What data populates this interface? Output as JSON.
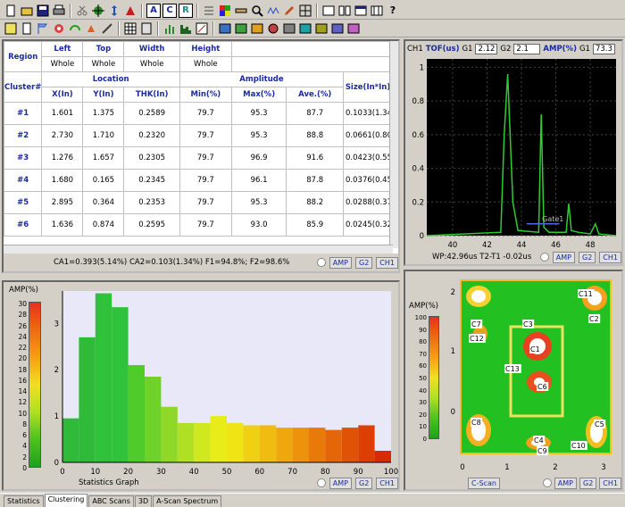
{
  "toolbar1": {
    "buttons": [
      "new-doc-icon",
      "open-folder-icon",
      "save-icon",
      "print-icon",
      "cut-icon",
      "arrow-icon",
      "crosshair-icon",
      "move-icon",
      "letter-a-icon",
      "letter-c-icon",
      "letter-r-icon",
      "list-icon",
      "palette-icon",
      "ruler-icon",
      "zoom-icon",
      "trace-icon",
      "pencil-icon",
      "grid-icon",
      "layout1-icon",
      "layout2-icon",
      "window-icon",
      "split-icon",
      "help-icon"
    ],
    "labels": {
      "a": "A",
      "c": "C",
      "r": "R",
      "help": "?"
    }
  },
  "table": {
    "col_headers_row1": [
      "Region",
      "Left",
      "Top",
      "Width",
      "Height",
      ""
    ],
    "col_headers_row2": [
      "",
      "Whole",
      "Whole",
      "Whole",
      "Whole",
      ""
    ],
    "group_row": {
      "cluster": "Cluster#",
      "location": "Location",
      "amplitude": "Amplitude",
      "size": "Size(In*In)"
    },
    "sub_headers": [
      "X(In)",
      "Y(In)",
      "THK(In)",
      "Min(%)",
      "Max(%)",
      "Ave.(%)"
    ],
    "rows": [
      {
        "id": "#1",
        "x": "1.601",
        "y": "1.375",
        "thk": "0.2589",
        "min": "79.7",
        "max": "95.3",
        "ave": "87.7",
        "size": "0.1033(1.34"
      },
      {
        "id": "#2",
        "x": "2.730",
        "y": "1.710",
        "thk": "0.2320",
        "min": "79.7",
        "max": "95.3",
        "ave": "88.8",
        "size": "0.0661(0.80"
      },
      {
        "id": "#3",
        "x": "1.276",
        "y": "1.657",
        "thk": "0.2305",
        "min": "79.7",
        "max": "96.9",
        "ave": "91.6",
        "size": "0.0423(0.55"
      },
      {
        "id": "#4",
        "x": "1.680",
        "y": "0.165",
        "thk": "0.2345",
        "min": "79.7",
        "max": "96.1",
        "ave": "87.8",
        "size": "0.0376(0.45"
      },
      {
        "id": "#5",
        "x": "2.895",
        "y": "0.364",
        "thk": "0.2353",
        "min": "79.7",
        "max": "95.3",
        "ave": "88.2",
        "size": "0.0288(0.37"
      },
      {
        "id": "#6",
        "x": "1.636",
        "y": "0.874",
        "thk": "0.2595",
        "min": "79.7",
        "max": "93.0",
        "ave": "85.9",
        "size": "0.0245(0.32"
      }
    ],
    "status": "CA1=0.393(5.14%) CA2=0.103(1.34%) F1=94.8%; F2=98.6%",
    "tabs": [
      "AMP",
      "G2",
      "CH1"
    ]
  },
  "ascan": {
    "channel": "CH1",
    "tof_label": "TOF(us)",
    "g1_label": "G1",
    "g1_value": "2.12",
    "g2_label": "G2",
    "g2_value": "2.1",
    "amp_label": "AMP(%)",
    "amp_g1_label": "G1",
    "amp_g1_value": "73.3",
    "gate_label": "Gate1",
    "readout": "WP:42.96us T2-T1 -0.02us",
    "tabs": [
      "AMP",
      "G2",
      "CH1"
    ],
    "accent": "#2ecc2e"
  },
  "histogram": {
    "legend_title": "AMP(%)",
    "legend_ticks": [
      "30",
      "28",
      "26",
      "24",
      "22",
      "20",
      "18",
      "16",
      "14",
      "12",
      "10",
      "8",
      "6",
      "4",
      "2",
      "0"
    ],
    "caption": "Statistics Graph",
    "tabs": [
      "AMP",
      "G2",
      "CH1"
    ]
  },
  "cscan": {
    "legend_title": "AMP(%)",
    "legend_ticks": [
      "100",
      "90",
      "80",
      "70",
      "60",
      "50",
      "40",
      "30",
      "20",
      "10",
      "0"
    ],
    "x_ticks": [
      "0",
      "1",
      "2",
      "3"
    ],
    "y_ticks": [
      "2",
      "1",
      "0"
    ],
    "labels": [
      "C11",
      "C7",
      "C3",
      "C2",
      "C12",
      "C1",
      "C13",
      "C6",
      "C8",
      "C4",
      "C9",
      "C10",
      "C5"
    ],
    "tabs": [
      "C-Scan",
      "AMP",
      "G2",
      "CH1"
    ]
  },
  "bottom_tabs": [
    "Statistics",
    "Clustering",
    "ABC Scans",
    "3D",
    "A-Scan Spectrum"
  ],
  "chart_data": [
    {
      "type": "bar",
      "x": [
        0,
        5,
        10,
        15,
        20,
        25,
        30,
        35,
        40,
        45,
        50,
        55,
        60,
        65,
        70,
        75,
        80,
        85,
        90,
        95
      ],
      "values": [
        0.95,
        2.7,
        3.65,
        3.35,
        2.1,
        1.85,
        1.2,
        0.85,
        0.85,
        1.0,
        0.85,
        0.8,
        0.8,
        0.75,
        0.75,
        0.75,
        0.7,
        0.75,
        0.8,
        0.25
      ],
      "xlim": [
        0,
        100
      ],
      "ylim": [
        0,
        3.7
      ],
      "x_ticks": [
        "0",
        "10",
        "20",
        "30",
        "40",
        "50",
        "60",
        "70",
        "80",
        "90",
        "100"
      ],
      "y_ticks": [
        "0",
        "1",
        "2",
        "3"
      ],
      "colors": [
        "#2fba3a",
        "#2fba3a",
        "#2fc23a",
        "#2fc23a",
        "#4fcc2c",
        "#6fd22a",
        "#8fd828",
        "#b0e024",
        "#d0e81e",
        "#e8ec18",
        "#f0e414",
        "#f0d012",
        "#f0bc10",
        "#eea80e",
        "#ec920c",
        "#e87a0a",
        "#e46608",
        "#e05206",
        "#dc3e04",
        "#d82a02"
      ],
      "grid": false
    },
    {
      "type": "line",
      "x": [
        38.5,
        42.8,
        43.0,
        43.2,
        43.5,
        43.8,
        45.0,
        45.15,
        45.3,
        45.6,
        46.6,
        46.75,
        46.9,
        47.3,
        48.0,
        48.3,
        48.5,
        49.5
      ],
      "values": [
        0,
        0.02,
        0.6,
        0.96,
        0.2,
        0.03,
        0.02,
        0.72,
        0.05,
        0.02,
        0.02,
        0.19,
        0.03,
        0.02,
        0.01,
        0.07,
        0.01,
        0
      ],
      "xlim": [
        38.5,
        49.5
      ],
      "ylim": [
        0,
        1.05
      ],
      "x_ticks": [
        "40",
        "42",
        "44",
        "46",
        "48"
      ],
      "y_ticks": [
        "0",
        "0.2",
        "0.4",
        "0.6",
        "0.8",
        "1"
      ],
      "grid": true
    }
  ]
}
